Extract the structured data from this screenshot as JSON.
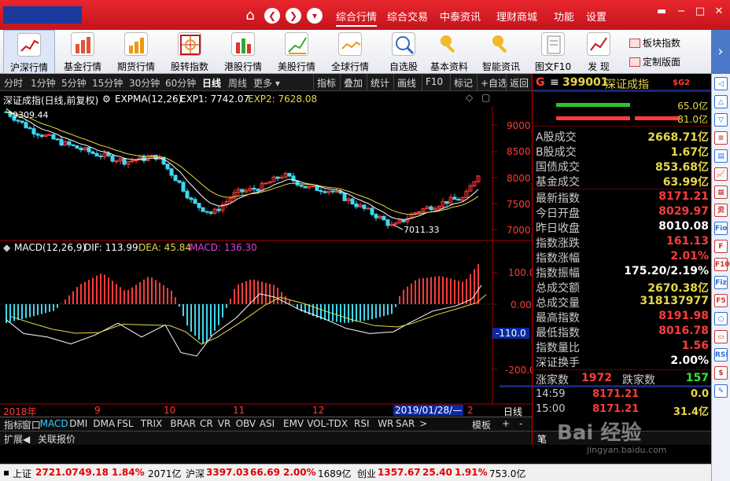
{
  "titlebar": {
    "menu": [
      "综合行情",
      "综合交易",
      "中泰资讯",
      "理财商城",
      "功能",
      "设置"
    ],
    "active_menu": "综合行情",
    "nav_buttons": [
      "❮",
      "❯",
      "▾"
    ]
  },
  "toolbar": {
    "tools": [
      {
        "label": "沪深行情",
        "icon": "line-chart-icon"
      },
      {
        "label": "基金行情",
        "icon": "bar-chart-icon"
      },
      {
        "label": "期货行情",
        "icon": "bar-chart-icon"
      },
      {
        "label": "股转指数",
        "icon": "grid-chart-icon"
      },
      {
        "label": "港股行情",
        "icon": "bar-chart-icon"
      },
      {
        "label": "美股行情",
        "icon": "bar-chart-icon"
      },
      {
        "label": "全球行情",
        "icon": "line-chart-icon"
      },
      {
        "label": "自选股",
        "icon": "search-chart-icon"
      },
      {
        "label": "基本资料",
        "icon": "key-icon"
      },
      {
        "label": "智能资讯",
        "icon": "key-icon"
      },
      {
        "label": "图文F10",
        "icon": "document-icon"
      },
      {
        "label": "发  现",
        "icon": "line-chart-icon"
      }
    ],
    "side_links": [
      "板块指数",
      "定制版面"
    ]
  },
  "periodbar": {
    "tabs": [
      "分时",
      "1分钟",
      "5分钟",
      "15分钟",
      "30分钟",
      "60分钟",
      "日线",
      "周线",
      "更多"
    ],
    "active": "日线",
    "right_tabs": [
      "指标",
      "叠加",
      "统计",
      "画线",
      "F10",
      "标记",
      "+自选",
      "返回"
    ]
  },
  "chart": {
    "title": "深证成指(日线,前复权)",
    "ma_label": "EXPMA(12,26)",
    "ema1_label": "EXP1: 7742.07",
    "ema2_label": "EXP2: 7628.08",
    "high_label": "9309.44",
    "low_label": "7011.33",
    "price_ticks": [
      "9000",
      "8500",
      "8000",
      "7500",
      "7000"
    ],
    "macd_label": "MACD(12,26,9)",
    "dif_label": "DIF: 113.99",
    "dea_label": "DEA: 45.84",
    "macd_value_label": "MACD: 136.30",
    "macd_ticks": [
      "100.0",
      "0.00",
      "-200.0"
    ],
    "macd_cursor": "-110.0",
    "date_labels": [
      "2018年",
      "9",
      "10",
      "11",
      "12",
      "2019/01/28/—",
      "2"
    ],
    "period_tag": "日线",
    "colors": {
      "up": "#ff3b3b",
      "down": "#3ed8f0",
      "ema1": "#ffffff",
      "ema2": "#e8d84a"
    }
  },
  "indicators": {
    "tabs": [
      "指标",
      "窗口",
      "MACD",
      "DMI",
      "DMA",
      "FSL",
      "TRIX",
      "BRAR",
      "CR",
      "VR",
      "OBV",
      "ASI",
      "EMV",
      "VOL-TDX",
      "RSI",
      "WR",
      "SAR",
      ">"
    ],
    "active": "MACD",
    "right": [
      "模板",
      "+",
      "-"
    ],
    "sub_tabs": [
      "扩展◀",
      "关联报价"
    ]
  },
  "quote": {
    "header_tag": "G",
    "header_menu": "≡",
    "code": "399001",
    "name": "深证成指",
    "badge": "$G2",
    "bar_up": "65.0亿",
    "bar_down": "81.0亿",
    "rows1": [
      {
        "label": "A股成交",
        "value": "2668.71亿",
        "color": "yellow"
      },
      {
        "label": "B股成交",
        "value": "1.67亿",
        "color": "yellow"
      },
      {
        "label": "国债成交",
        "value": "853.68亿",
        "color": "yellow"
      },
      {
        "label": "基金成交",
        "value": "63.99亿",
        "color": "yellow"
      }
    ],
    "rows2": [
      {
        "label": "最新指数",
        "value": "8171.21",
        "color": "red"
      },
      {
        "label": "今日开盘",
        "value": "8029.97",
        "color": "red"
      },
      {
        "label": "昨日收盘",
        "value": "8010.08",
        "color": "white"
      },
      {
        "label": "指数涨跌",
        "value": "161.13",
        "color": "red"
      },
      {
        "label": "指数涨幅",
        "value": "2.01%",
        "color": "red"
      },
      {
        "label": "指数振幅",
        "value": "175.20/2.19%",
        "color": "white"
      },
      {
        "label": "总成交额",
        "value": "2670.38亿",
        "color": "yellow"
      },
      {
        "label": "总成交量",
        "value": "318137977",
        "color": "yellow"
      },
      {
        "label": "最高指数",
        "value": "8191.98",
        "color": "red"
      },
      {
        "label": "最低指数",
        "value": "8016.78",
        "color": "red"
      },
      {
        "label": "指数量比",
        "value": "1.56",
        "color": "red"
      },
      {
        "label": "深证换手",
        "value": "2.00%",
        "color": "white"
      }
    ],
    "up_label": "涨家数",
    "up_count": "1972",
    "down_label": "跌家数",
    "down_count": "157",
    "ticks": [
      {
        "time": "14:59",
        "price": "8171.21",
        "vol": "0.0"
      },
      {
        "time": "15:00",
        "price": "8171.21",
        "vol": "31.4亿"
      }
    ],
    "bottom_tab": "笔"
  },
  "sidestrip": [
    "◁",
    "△",
    "▽",
    "≡",
    "▤",
    "📈",
    "▦",
    "资",
    "Fio",
    "F",
    "F10",
    "Fiz",
    "F5",
    "○",
    "▭",
    "RSI",
    "$",
    "✎"
  ],
  "status": {
    "sh_label": "上证",
    "sh_price": "2721.07",
    "sh_change": "49.18",
    "sh_pct": "1.84%",
    "sh_amount": "2071亿",
    "sz_label": "沪深",
    "sz_price": "3397.03",
    "sz_change": "66.69",
    "sz_pct": "2.00%",
    "sz_amount": "1689亿",
    "cy_label": "创业",
    "cy_price": "1357.67",
    "cy_change": "25.40",
    "cy_pct": "1.91%",
    "cy_amount": "753.0亿"
  },
  "watermark": {
    "text": "Bai 经验",
    "sub": "jingyan.baidu.com"
  }
}
